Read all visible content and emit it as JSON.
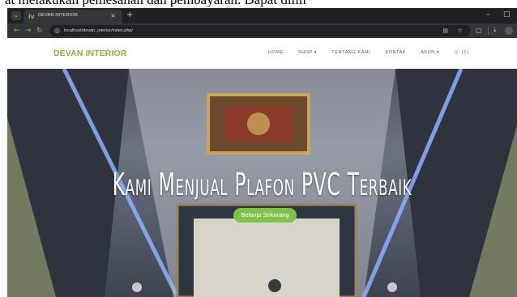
{
  "caption": {
    "text": "at melakukan pemesanan dan pembayaran. Dapat dilih"
  },
  "browser": {
    "tab_title": "DEVAN INTERIOR",
    "tab_close": "×",
    "new_tab": "+",
    "url": "localhost/devan_interior/index.php/",
    "window_min": "–",
    "window_max": "□"
  },
  "site": {
    "brand": "DEVAN INTERIOR",
    "menu": [
      {
        "label": "HOME"
      },
      {
        "label": "SHOP ▾"
      },
      {
        "label": "TENTANG KAMI"
      },
      {
        "label": "KONTAK"
      },
      {
        "label": "AKUN ▾"
      },
      {
        "label": "🛒 (1)"
      }
    ]
  },
  "hero": {
    "title": "Kami Menjual Plafon PVC Terbaik",
    "cta_label": "Belanja Sekarang"
  },
  "colors": {
    "brand": "#86b33b",
    "cta": "#7fc24a",
    "browser_bg": "#202124"
  }
}
